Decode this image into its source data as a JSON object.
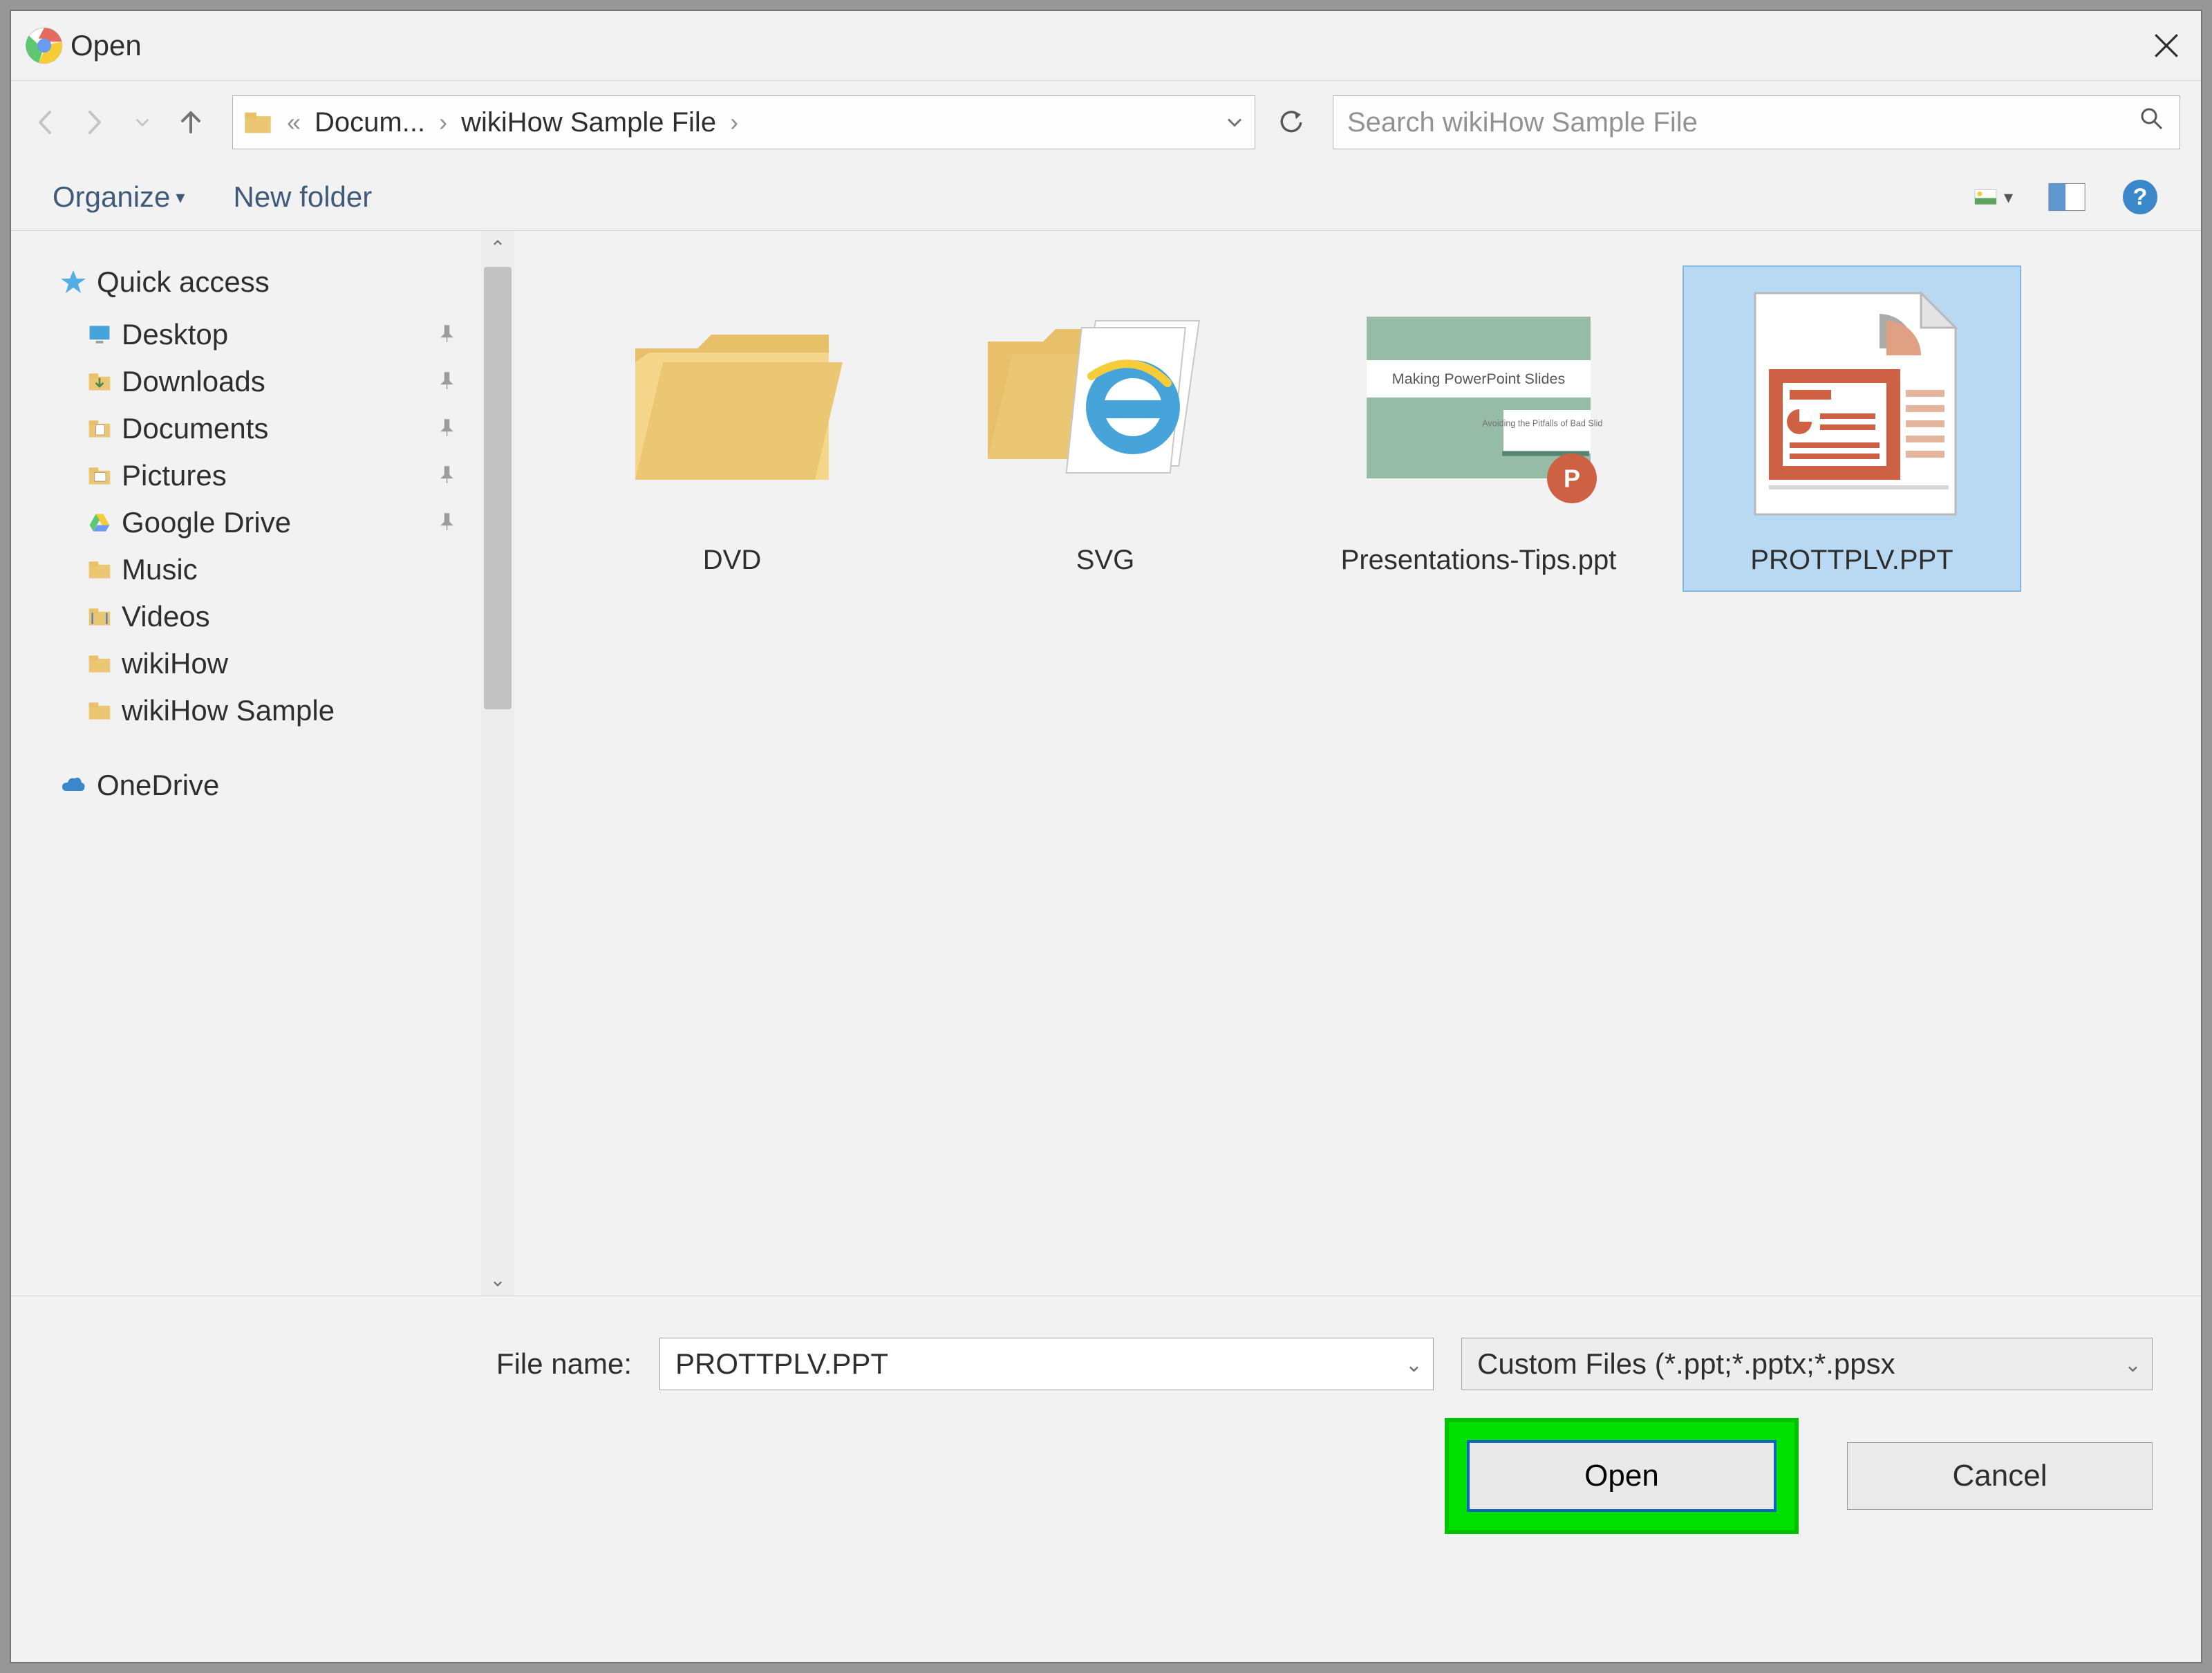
{
  "dialog_title": "Open",
  "breadcrumb": {
    "ellipsis": "«",
    "items": [
      "Docum...",
      "wikiHow Sample File"
    ]
  },
  "search_placeholder": "Search wikiHow Sample File",
  "toolbar": {
    "organize": "Organize",
    "new_folder": "New folder"
  },
  "navpane": {
    "quick_access": "Quick access",
    "items": [
      {
        "label": "Desktop",
        "pinned": true
      },
      {
        "label": "Downloads",
        "pinned": true
      },
      {
        "label": "Documents",
        "pinned": true
      },
      {
        "label": "Pictures",
        "pinned": true
      },
      {
        "label": "Google Drive",
        "pinned": true
      },
      {
        "label": "Music",
        "pinned": false
      },
      {
        "label": "Videos",
        "pinned": false
      },
      {
        "label": "wikiHow",
        "pinned": false
      },
      {
        "label": "wikiHow Sample",
        "pinned": false
      }
    ],
    "onedrive": "OneDrive"
  },
  "files": [
    {
      "name": "DVD",
      "kind": "folder"
    },
    {
      "name": "SVG",
      "kind": "folder-ie"
    },
    {
      "name": "Presentations-Tips.ppt",
      "kind": "ppt-thumb",
      "thumb_title": "Making PowerPoint Slides",
      "thumb_sub": "Avoiding the Pitfalls of Bad Slides"
    },
    {
      "name": "PROTTPLV.PPT",
      "kind": "ppt-generic",
      "selected": true
    }
  ],
  "footer": {
    "file_name_label": "File name:",
    "file_name_value": "PROTTPLV.PPT",
    "filter": "Custom Files (*.ppt;*.pptx;*.ppsx",
    "open": "Open",
    "cancel": "Cancel"
  }
}
